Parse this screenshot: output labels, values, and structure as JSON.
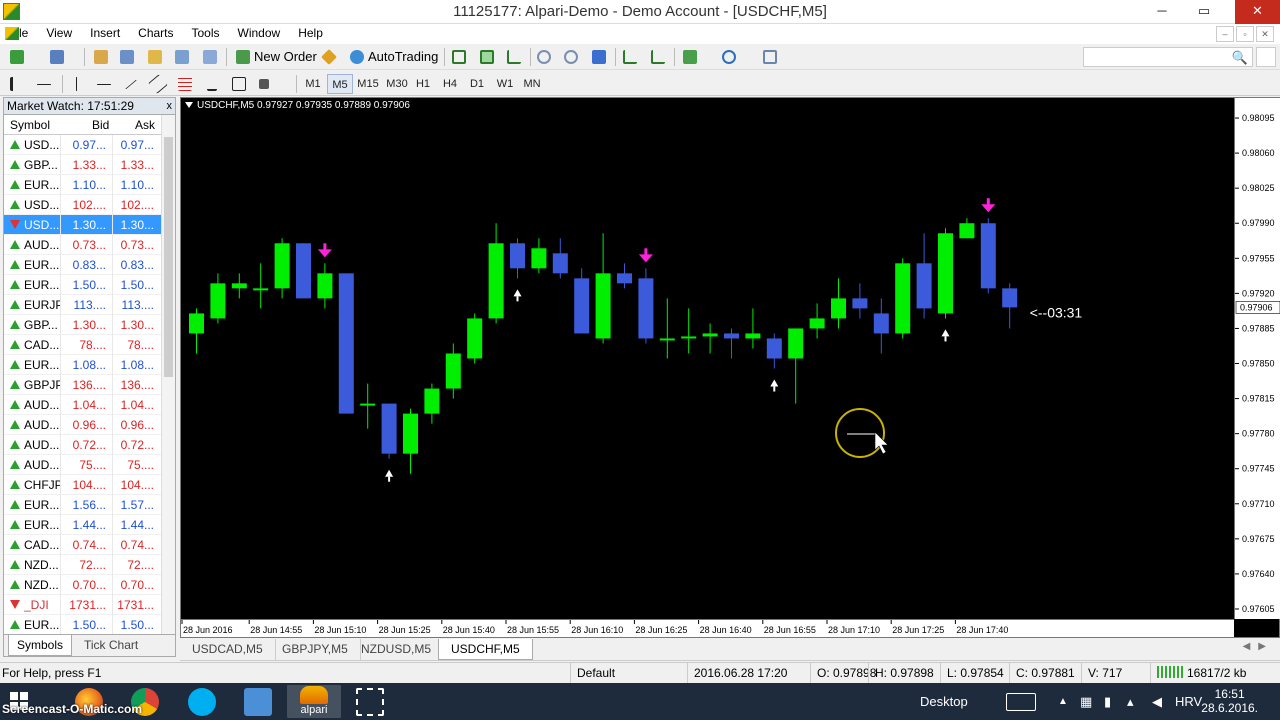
{
  "window": {
    "title": "11125177: Alpari-Demo - Demo Account - [USDCHF,M5]",
    "minimize": "─",
    "maximize": "▭",
    "close": "✕"
  },
  "menu": [
    "File",
    "View",
    "Insert",
    "Charts",
    "Tools",
    "Window",
    "Help"
  ],
  "mdi_buttons": [
    "‒",
    "▫",
    "✕"
  ],
  "toolbar": {
    "new_order": "New Order",
    "auto_trading": "AutoTrading",
    "timeframes": [
      "M1",
      "M5",
      "M15",
      "M30",
      "H1",
      "H4",
      "D1",
      "W1",
      "MN"
    ],
    "active_timeframe": "M5",
    "search_icon": "🔍"
  },
  "market_watch": {
    "title": "Market Watch: 17:51:29",
    "close": "x",
    "columns": {
      "symbol": "Symbol",
      "bid": "Bid",
      "ask": "Ask"
    },
    "rows": [
      {
        "symbol": "USD...",
        "bid": "0.97...",
        "ask": "0.97...",
        "dir": "up"
      },
      {
        "symbol": "GBP...",
        "bid": "1.33...",
        "ask": "1.33...",
        "dir": "up",
        "color": "red"
      },
      {
        "symbol": "EUR...",
        "bid": "1.10...",
        "ask": "1.10...",
        "dir": "up"
      },
      {
        "symbol": "USD...",
        "bid": "102....",
        "ask": "102....",
        "dir": "up",
        "color": "red"
      },
      {
        "symbol": "USD...",
        "bid": "1.30...",
        "ask": "1.30...",
        "dir": "dn",
        "selected": true
      },
      {
        "symbol": "AUD...",
        "bid": "0.73...",
        "ask": "0.73...",
        "dir": "up",
        "color": "red"
      },
      {
        "symbol": "EUR...",
        "bid": "0.83...",
        "ask": "0.83...",
        "dir": "up"
      },
      {
        "symbol": "EUR...",
        "bid": "1.50...",
        "ask": "1.50...",
        "dir": "up"
      },
      {
        "symbol": "EURJPY",
        "bid": "113....",
        "ask": "113....",
        "dir": "up"
      },
      {
        "symbol": "GBP...",
        "bid": "1.30...",
        "ask": "1.30...",
        "dir": "up",
        "color": "red"
      },
      {
        "symbol": "CAD...",
        "bid": "78....",
        "ask": "78....",
        "dir": "up",
        "color": "red"
      },
      {
        "symbol": "EUR...",
        "bid": "1.08...",
        "ask": "1.08...",
        "dir": "up"
      },
      {
        "symbol": "GBPJPY",
        "bid": "136....",
        "ask": "136....",
        "dir": "up",
        "color": "red"
      },
      {
        "symbol": "AUD...",
        "bid": "1.04...",
        "ask": "1.04...",
        "dir": "up",
        "color": "red"
      },
      {
        "symbol": "AUD...",
        "bid": "0.96...",
        "ask": "0.96...",
        "dir": "up",
        "color": "red"
      },
      {
        "symbol": "AUD...",
        "bid": "0.72...",
        "ask": "0.72...",
        "dir": "up",
        "color": "red"
      },
      {
        "symbol": "AUD...",
        "bid": "75....",
        "ask": "75....",
        "dir": "up",
        "color": "red"
      },
      {
        "symbol": "CHFJPY",
        "bid": "104....",
        "ask": "104....",
        "dir": "up",
        "color": "red"
      },
      {
        "symbol": "EUR...",
        "bid": "1.56...",
        "ask": "1.57...",
        "dir": "up"
      },
      {
        "symbol": "EUR...",
        "bid": "1.44...",
        "ask": "1.44...",
        "dir": "up"
      },
      {
        "symbol": "CAD...",
        "bid": "0.74...",
        "ask": "0.74...",
        "dir": "up",
        "color": "red"
      },
      {
        "symbol": "NZD...",
        "bid": "72....",
        "ask": "72....",
        "dir": "up",
        "color": "red"
      },
      {
        "symbol": "NZD...",
        "bid": "0.70...",
        "ask": "0.70...",
        "dir": "up",
        "color": "red"
      },
      {
        "symbol": "_DJI",
        "bid": "1731...",
        "ask": "1731...",
        "dir": "dn",
        "dim": true
      },
      {
        "symbol": "EUR...",
        "bid": "1.50...",
        "ask": "1.50...",
        "dir": "up"
      }
    ],
    "tabs": [
      "Symbols",
      "Tick Chart"
    ]
  },
  "chart": {
    "header": "USDCHF,M5  0.97927 0.97935 0.97889 0.97906",
    "countdown": "<--03:31",
    "current_price": "0.97906",
    "colors": {
      "bull": "#00ee00",
      "bear": "#3b5bdb",
      "buy_arrow": "#ffffff",
      "sell_arrow": "#ff22dd",
      "cursor_ring": "#c8b400"
    }
  },
  "chart_data": {
    "type": "candlestick",
    "title": "USDCHF,M5",
    "ylim": [
      0.97595,
      0.98115
    ],
    "y_ticks": [
      "0.98095",
      "0.98060",
      "0.98025",
      "0.97990",
      "0.97955",
      "0.97920",
      "0.97885",
      "0.97850",
      "0.97815",
      "0.97780",
      "0.97745",
      "0.97710",
      "0.97675",
      "0.97640",
      "0.97605"
    ],
    "x_ticks": [
      "28 Jun 2016",
      "28 Jun 14:55",
      "28 Jun 15:10",
      "28 Jun 15:25",
      "28 Jun 15:40",
      "28 Jun 15:55",
      "28 Jun 16:10",
      "28 Jun 16:25",
      "28 Jun 16:40",
      "28 Jun 16:55",
      "28 Jun 17:10",
      "28 Jun 17:25",
      "28 Jun 17:40"
    ],
    "candles": [
      {
        "o": 0.9788,
        "h": 0.97905,
        "l": 0.9786,
        "c": 0.979
      },
      {
        "o": 0.97895,
        "h": 0.9794,
        "l": 0.9789,
        "c": 0.9793
      },
      {
        "o": 0.97925,
        "h": 0.9794,
        "l": 0.97915,
        "c": 0.9793
      },
      {
        "o": 0.97925,
        "h": 0.9795,
        "l": 0.97905,
        "c": 0.97925
      },
      {
        "o": 0.97925,
        "h": 0.97975,
        "l": 0.97915,
        "c": 0.9797
      },
      {
        "o": 0.9797,
        "h": 0.9797,
        "l": 0.97915,
        "c": 0.97915
      },
      {
        "o": 0.97915,
        "h": 0.9795,
        "l": 0.97905,
        "c": 0.9794
      },
      {
        "o": 0.9794,
        "h": 0.9794,
        "l": 0.978,
        "c": 0.978
      },
      {
        "o": 0.9781,
        "h": 0.9783,
        "l": 0.97785,
        "c": 0.9781
      },
      {
        "o": 0.9781,
        "h": 0.9781,
        "l": 0.97755,
        "c": 0.9776
      },
      {
        "o": 0.9776,
        "h": 0.97805,
        "l": 0.9774,
        "c": 0.978
      },
      {
        "o": 0.978,
        "h": 0.9783,
        "l": 0.9779,
        "c": 0.97825
      },
      {
        "o": 0.97825,
        "h": 0.9787,
        "l": 0.97815,
        "c": 0.9786
      },
      {
        "o": 0.97855,
        "h": 0.979,
        "l": 0.9785,
        "c": 0.97895
      },
      {
        "o": 0.97895,
        "h": 0.9799,
        "l": 0.9789,
        "c": 0.9797
      },
      {
        "o": 0.9797,
        "h": 0.97975,
        "l": 0.97935,
        "c": 0.97945
      },
      {
        "o": 0.97945,
        "h": 0.97975,
        "l": 0.9794,
        "c": 0.97965
      },
      {
        "o": 0.9796,
        "h": 0.97975,
        "l": 0.97935,
        "c": 0.9794
      },
      {
        "o": 0.97935,
        "h": 0.97945,
        "l": 0.9788,
        "c": 0.9788
      },
      {
        "o": 0.97875,
        "h": 0.9798,
        "l": 0.9787,
        "c": 0.9794
      },
      {
        "o": 0.9794,
        "h": 0.9795,
        "l": 0.97925,
        "c": 0.9793
      },
      {
        "o": 0.97935,
        "h": 0.97945,
        "l": 0.9787,
        "c": 0.97875
      },
      {
        "o": 0.97875,
        "h": 0.97915,
        "l": 0.97855,
        "c": 0.97875
      },
      {
        "o": 0.97875,
        "h": 0.97905,
        "l": 0.9786,
        "c": 0.97877
      },
      {
        "o": 0.97877,
        "h": 0.9789,
        "l": 0.9786,
        "c": 0.9788
      },
      {
        "o": 0.9788,
        "h": 0.97885,
        "l": 0.97855,
        "c": 0.97875
      },
      {
        "o": 0.97875,
        "h": 0.97905,
        "l": 0.97865,
        "c": 0.9788
      },
      {
        "o": 0.97875,
        "h": 0.9788,
        "l": 0.97845,
        "c": 0.97855
      },
      {
        "o": 0.97855,
        "h": 0.97885,
        "l": 0.9781,
        "c": 0.97885
      },
      {
        "o": 0.97885,
        "h": 0.9791,
        "l": 0.97875,
        "c": 0.97895
      },
      {
        "o": 0.97895,
        "h": 0.97935,
        "l": 0.97885,
        "c": 0.97915
      },
      {
        "o": 0.97915,
        "h": 0.9793,
        "l": 0.97895,
        "c": 0.97905
      },
      {
        "o": 0.979,
        "h": 0.97915,
        "l": 0.9786,
        "c": 0.9788
      },
      {
        "o": 0.9788,
        "h": 0.97955,
        "l": 0.97875,
        "c": 0.9795
      },
      {
        "o": 0.9795,
        "h": 0.9798,
        "l": 0.97895,
        "c": 0.97905
      },
      {
        "o": 0.979,
        "h": 0.97985,
        "l": 0.97895,
        "c": 0.9798
      },
      {
        "o": 0.97975,
        "h": 0.97995,
        "l": 0.97975,
        "c": 0.9799
      },
      {
        "o": 0.9799,
        "h": 0.97995,
        "l": 0.9792,
        "c": 0.97925
      },
      {
        "o": 0.97925,
        "h": 0.9793,
        "l": 0.97885,
        "c": 0.97906
      }
    ],
    "buy_arrows": [
      9,
      15,
      27,
      35
    ],
    "sell_arrows": [
      6,
      21,
      37
    ]
  },
  "chart_tabs": [
    "USDCAD,M5",
    "GBPJPY,M5",
    "NZDUSD,M5",
    "USDCHF,M5"
  ],
  "active_chart_tab": "USDCHF,M5",
  "status": {
    "help": "For Help, press F1",
    "profile": "Default",
    "datetime": "2016.06.28 17:20",
    "open": "O: 0.97898",
    "high": "H: 0.97898",
    "low": "L: 0.97854",
    "close": "C: 0.97881",
    "volume": "V: 717",
    "traffic": "16817/2 kb"
  },
  "taskbar": {
    "watermark": "Screencast-O-Matic.com",
    "alpari_label": "alpari",
    "desktop": "Desktop",
    "language": "HRV",
    "time": "16:51",
    "date": "28.6.2016."
  }
}
